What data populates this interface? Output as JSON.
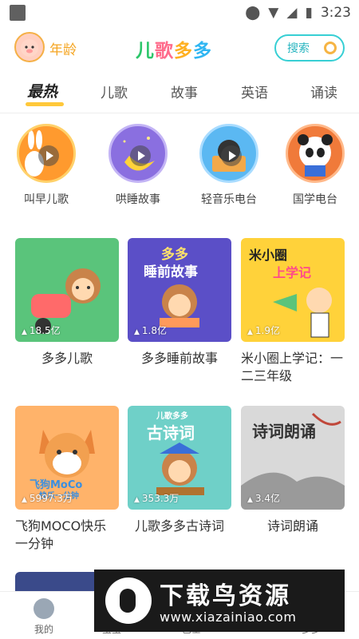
{
  "status_bar": {
    "time": "3:23"
  },
  "header": {
    "age_label": "年龄",
    "logo_chars": [
      "儿",
      "歌",
      "多",
      "多"
    ],
    "search_label": "搜索"
  },
  "tabs": [
    {
      "label": "最热",
      "active": true
    },
    {
      "label": "儿歌",
      "active": false
    },
    {
      "label": "故事",
      "active": false
    },
    {
      "label": "英语",
      "active": false
    },
    {
      "label": "诵读",
      "active": false
    }
  ],
  "radio_stations": [
    {
      "label": "叫早儿歌",
      "color": "#ff9a2e"
    },
    {
      "label": "哄睡故事",
      "color": "#8a6fe0"
    },
    {
      "label": "轻音乐电台",
      "color": "#5bb8f2"
    },
    {
      "label": "国学电台",
      "color": "#f07a3a"
    }
  ],
  "cards": [
    {
      "title": "多多儿歌",
      "count": "18.5亿",
      "color": "#5ac47b"
    },
    {
      "title": "多多睡前故事",
      "count": "1.8亿",
      "color": "#5b4fc7",
      "img_text_1": "多多",
      "img_text_2": "睡前故事"
    },
    {
      "title": "米小圈上学记：一二三年级",
      "count": "1.9亿",
      "color": "#ffd23a",
      "img_text_1": "米小圈",
      "img_text_2": "上学记"
    },
    {
      "title": "飞狗MOCO快乐一分钟",
      "count": "5997.3万",
      "color": "#ffb36a",
      "img_text_1": "飞狗MoCo",
      "img_text_2": "快乐一分钟"
    },
    {
      "title": "儿歌多多古诗词",
      "count": "353.3万",
      "color": "#6fd0c8",
      "img_text_1": "儿歌多多",
      "img_text_2": "古诗词"
    },
    {
      "title": "诗词朗诵",
      "count": "3.4亿",
      "color": "#d9d9d9",
      "img_text_1": "诗词朗诵"
    }
  ],
  "bottom_nav": [
    {
      "label": "我的"
    },
    {
      "label": "宝宝"
    },
    {
      "label": "巴士"
    },
    {
      "label": "多多"
    }
  ],
  "watermark": {
    "title": "下载鸟资源",
    "url": "www.xiazainiao.com"
  }
}
